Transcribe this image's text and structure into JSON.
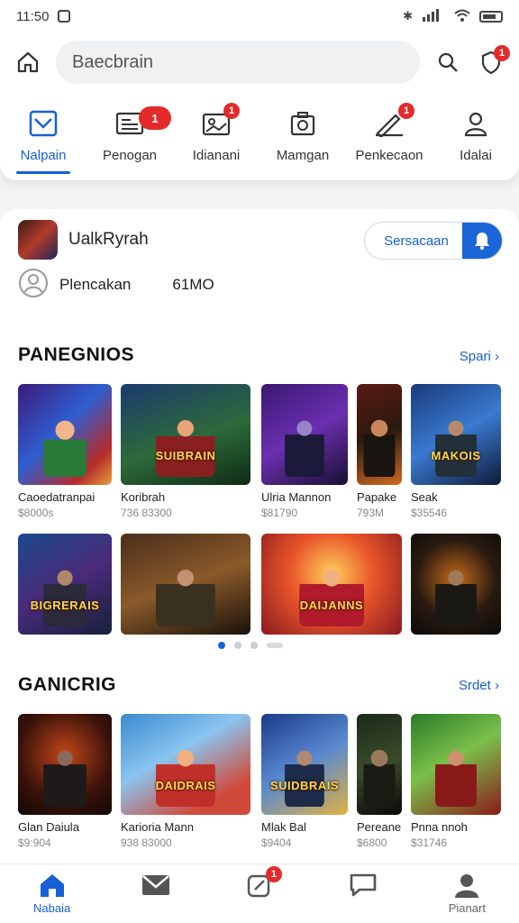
{
  "status": {
    "time": "11:50"
  },
  "topbar": {
    "search_value": "Baecbrain",
    "notif_badge": "1"
  },
  "categories": [
    {
      "label": "Nalpain",
      "icon": "image-icon",
      "active": true,
      "badge": ""
    },
    {
      "label": "Penogan",
      "icon": "news-icon",
      "active": false,
      "badge": "1"
    },
    {
      "label": "Idianani",
      "icon": "gallery-icon",
      "active": false,
      "badge": "1"
    },
    {
      "label": "Mamgan",
      "icon": "camera-icon",
      "active": false,
      "badge": ""
    },
    {
      "label": "Penkecaon",
      "icon": "edit-icon",
      "active": false,
      "badge": "1"
    },
    {
      "label": "Idalai",
      "icon": "person-icon",
      "active": false,
      "badge": ""
    }
  ],
  "profile": {
    "name": "UalkRyrah",
    "subscribe_label": "Sersacaan",
    "meta_label": "Plencakan",
    "meta_value": "61MO"
  },
  "section1": {
    "title": "PANEGNIOS",
    "see_all": "Spari",
    "row1": [
      {
        "name": "Caoedatranpai",
        "price": "$8000s",
        "art": ""
      },
      {
        "name": "Koribrah",
        "price": "736 83300",
        "art": "SUIBRAIN"
      },
      {
        "name": "Ulria Mannon",
        "price": "$81790",
        "art": ""
      },
      {
        "name": "Papake",
        "price": "793M",
        "art": ""
      },
      {
        "name": "Seak",
        "price": "$35546",
        "art": "MAKOIS"
      }
    ],
    "row2": [
      {
        "art": "BIGRERAIS"
      },
      {
        "art": ""
      },
      {
        "art": "DAIJANNS"
      },
      {
        "art": ""
      }
    ]
  },
  "section2": {
    "title": "GANICRIG",
    "see_all": "Srdet",
    "row": [
      {
        "name": "Glan Daiula",
        "price": "$9:904",
        "art": ""
      },
      {
        "name": "Karioria Mann",
        "price": "938 83000",
        "art": "DAIDRAIS"
      },
      {
        "name": "Mlak Bal",
        "price": "$9404",
        "art": "SUIDBRAIS"
      },
      {
        "name": "Pereane",
        "price": "$6800",
        "art": ""
      },
      {
        "name": "Pnna nnoh",
        "price": "$31746",
        "art": ""
      }
    ]
  },
  "bottom_nav": [
    {
      "label": "Nabaia",
      "icon": "home-icon",
      "active": true,
      "badge": ""
    },
    {
      "label": "",
      "icon": "mail-icon",
      "active": false,
      "badge": ""
    },
    {
      "label": "",
      "icon": "compass-icon",
      "active": false,
      "badge": "1"
    },
    {
      "label": "",
      "icon": "chat-icon",
      "active": false,
      "badge": ""
    },
    {
      "label": "Pianart",
      "icon": "profile-icon",
      "active": false,
      "badge": ""
    }
  ]
}
